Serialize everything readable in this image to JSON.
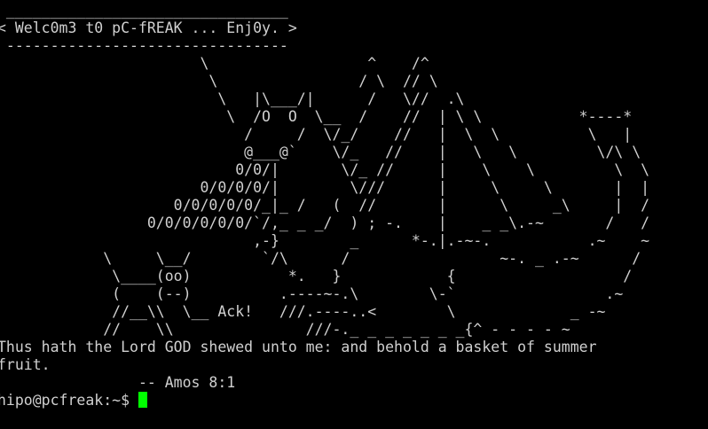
{
  "terminal": {
    "banner": [
      " ________________________________",
      "< Welc0m3 t0 pC-fREAK ... Enj0y. >",
      " --------------------------------"
    ],
    "art": [
      "                       \\                  ^    /^",
      "                        \\                / \\  // \\",
      "                         \\   |\\___/|      /   \\//  .\\",
      "                          \\  /O  O  \\__  /    //  | \\ \\           *----*",
      "                            /     /  \\/_/    //   |  \\  \\          \\   |",
      "                            @___@`    \\/_   //    |   \\   \\         \\/\\ \\",
      "                           0/0/|       \\/_ //     |    \\    \\         \\  \\",
      "                       0/0/0/0/|        \\///      |     \\     \\       |  |",
      "                    0/0/0/0/0/_|_ /   (  //       |      \\     _\\     |  /",
      "                 0/0/0/0/0/0/`/,_ _ _/  ) ; -.    |    _ _\\.-~       /   /",
      "                             ,-}        _      *-.|.-~-.           .~    ~",
      "            \\     \\__/        `/\\      /                 ~-. _ .-~      /",
      "             \\____(oo)           *.   }            {                   /",
      "             (    (--)          .----~-.\\        \\-`                 .~",
      "             //__\\\\  \\__ Ack!   ///.----..<        \\             _ -~",
      "            //    \\\\               ///-._ _ _ _ _ _ _{^ - - - - ~"
    ],
    "quote_line_1": "Thus hath the Lord GOD shewed unto me: and behold a basket of summer",
    "quote_line_2": "fruit.",
    "attribution": "                -- Amos 8:1",
    "prompt": "hipo@pcfreak:~$ ",
    "cursor_color": "#00ff00",
    "text_color": "#d0d0d0",
    "background_color": "#000000"
  }
}
